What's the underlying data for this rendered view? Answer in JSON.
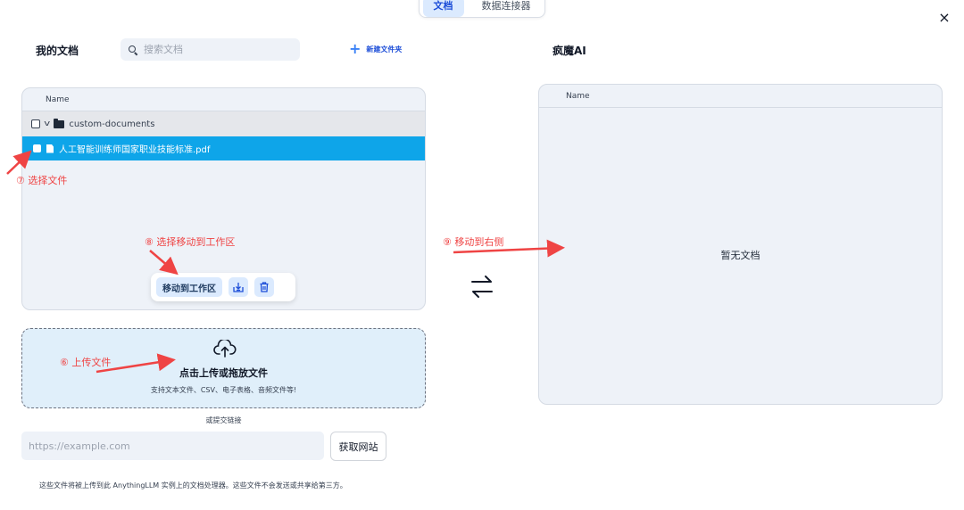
{
  "tabs": [
    {
      "label": "文档",
      "active": true
    },
    {
      "label": "数据连接器",
      "active": false
    }
  ],
  "close_label": "×",
  "left": {
    "title": "我的文档",
    "search_placeholder": "搜索文档",
    "new_folder_label": "新建文件夹",
    "column_name": "Name",
    "folder_name": "custom-documents",
    "file_name": "人工智能训练师国家职业技能标准.pdf",
    "move_to_workspace_label": "移动到工作区"
  },
  "right": {
    "title": "疯魔AI",
    "column_name": "Name",
    "empty_text": "暂无文档"
  },
  "upload": {
    "title": "点击上传或拖放文件",
    "subtitle": "支持文本文件、CSV、电子表格、音频文件等!"
  },
  "link": {
    "or_label": "或提交链接",
    "url_placeholder": "https://example.com",
    "fetch_label": "获取网站"
  },
  "footer_note": "这些文件将被上传到此 AnythingLLM 实例上的文档处理器。这些文件不会发送或共享给第三方。",
  "annotations": {
    "step6": "⑥ 上传文件",
    "step7": "⑦ 选择文件",
    "step8": "⑧ 选择移动到工作区",
    "step9": "⑨ 移动到右侧"
  },
  "colors": {
    "accent": "#0ea5e9",
    "annotation": "#ef4444",
    "panel_bg": "#eef2f8",
    "upload_bg": "#e0effa"
  }
}
